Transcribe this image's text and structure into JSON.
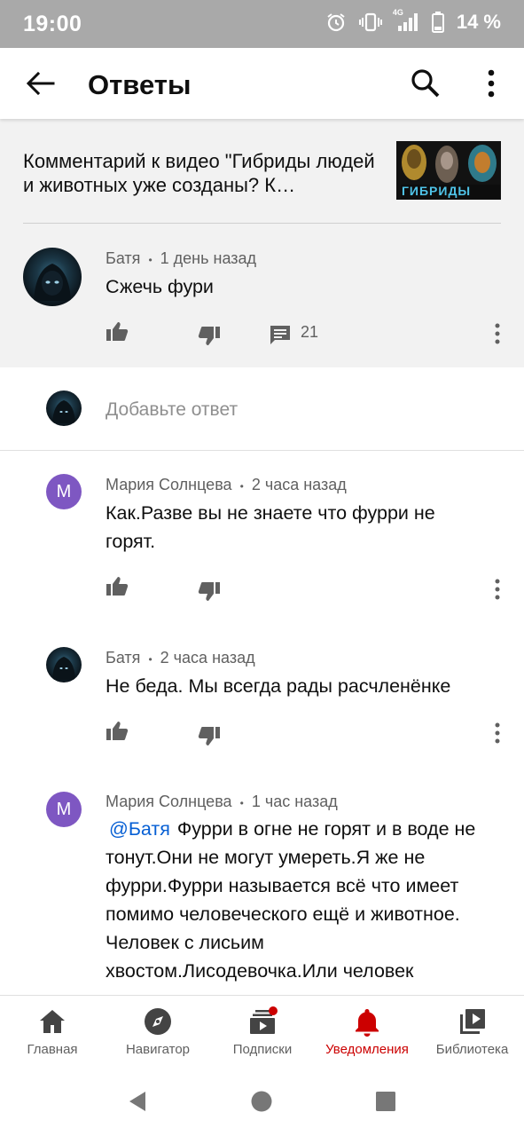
{
  "status": {
    "time": "19:00",
    "network": "4G",
    "battery": "14 %"
  },
  "appbar": {
    "title": "Ответы"
  },
  "video": {
    "title": "Комментарий к видео \"Гибриды людей и животных уже созданы? К…",
    "thumb_text": "ГИБРИДЫ"
  },
  "parent_comment": {
    "author": "Батя",
    "time": "1 день назад",
    "text": "Сжечь фури",
    "reply_count": "21"
  },
  "reply_box": {
    "placeholder": "Добавьте ответ"
  },
  "replies": [
    {
      "author": "Мария Солнцева",
      "time": "2 часа назад",
      "avatar_letter": "М",
      "text": "Как.Разве вы не знаете что фурри не горят."
    },
    {
      "author": "Батя",
      "time": "2 часа назад",
      "text": "Не беда. Мы всегда рады расчленёнке"
    },
    {
      "author": "Мария Солнцева",
      "time": "1 час назад",
      "avatar_letter": "М",
      "mention": "@Батя",
      "text": "Фурри в огне не горят и в воде не тонут.Они не могут умереть.Я же не фурри.Фурри называется всё что имеет помимо человеческого ещё и животное. Человек с лисьим хвостом.Лисодевочка.Или человек"
    }
  ],
  "meta_separator": "•",
  "bottom_nav": [
    {
      "label": "Главная",
      "icon": "home-icon"
    },
    {
      "label": "Навигатор",
      "icon": "compass-icon"
    },
    {
      "label": "Подписки",
      "icon": "subscriptions-icon"
    },
    {
      "label": "Уведомления",
      "icon": "bell-icon",
      "active": true
    },
    {
      "label": "Библиотека",
      "icon": "library-icon"
    }
  ],
  "colors": {
    "accent": "#cc0000",
    "link": "#065fd4",
    "avatar_m": "#7e57c2",
    "statusbar": "#a9a9a9"
  }
}
